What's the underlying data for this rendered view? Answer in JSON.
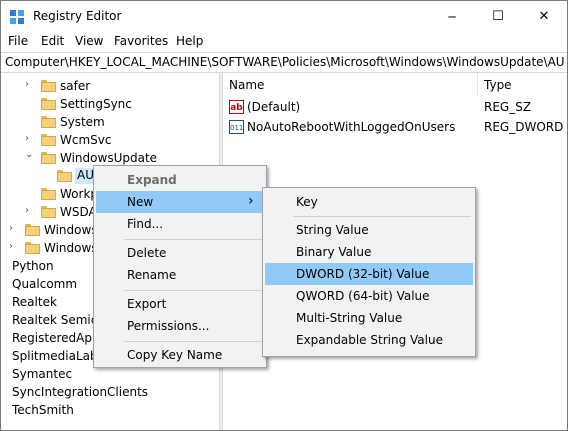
{
  "window": {
    "title": "Registry Editor",
    "controls": {
      "minimize": "─",
      "maximize": "☐",
      "close": "✕"
    }
  },
  "menu": [
    "File",
    "Edit",
    "View",
    "Favorites",
    "Help"
  ],
  "address": "Computer\\HKEY_LOCAL_MACHINE\\SOFTWARE\\Policies\\Microsoft\\Windows\\WindowsUpdate\\AU",
  "tree": {
    "items": [
      {
        "label": "safer",
        "arrow": "›"
      },
      {
        "label": "SettingSync",
        "arrow": ""
      },
      {
        "label": "System",
        "arrow": ""
      },
      {
        "label": "WcmSvc",
        "arrow": "›"
      },
      {
        "label": "WindowsUpdate",
        "arrow": "⌄"
      },
      {
        "label": "AU",
        "arrow": ""
      },
      {
        "label": "Workp",
        "arrow": ""
      },
      {
        "label": "WSDA",
        "arrow": "›"
      },
      {
        "label": "Windows",
        "arrow": "›"
      },
      {
        "label": "Windows",
        "arrow": "›"
      },
      {
        "label": "Python",
        "arrow": ""
      },
      {
        "label": "Qualcomm",
        "arrow": ""
      },
      {
        "label": "Realtek",
        "arrow": ""
      },
      {
        "label": "Realtek Semico",
        "arrow": ""
      },
      {
        "label": "RegisteredAppl",
        "arrow": ""
      },
      {
        "label": "SplitmediaLabs",
        "arrow": ""
      },
      {
        "label": "Symantec",
        "arrow": ""
      },
      {
        "label": "SyncIntegrationClients",
        "arrow": ""
      },
      {
        "label": "TechSmith",
        "arrow": ""
      }
    ]
  },
  "values": {
    "headers": {
      "name": "Name",
      "type": "Type"
    },
    "rows": [
      {
        "icon": "ab",
        "name": "(Default)",
        "type": "REG_SZ"
      },
      {
        "icon": "011",
        "name": "NoAutoRebootWithLoggedOnUsers",
        "type": "REG_DWORD"
      }
    ]
  },
  "context_menu": {
    "items": [
      "Expand",
      "New",
      "Find...",
      "Delete",
      "Rename",
      "Export",
      "Permissions...",
      "Copy Key Name"
    ],
    "submenu_arrow": "›"
  },
  "new_submenu": {
    "items": [
      "Key",
      "String Value",
      "Binary Value",
      "DWORD (32-bit) Value",
      "QWORD (64-bit) Value",
      "Multi-String Value",
      "Expandable String Value"
    ]
  },
  "colors": {
    "highlight": "#91c9f7",
    "disabled_text": "#6d6d6d"
  }
}
